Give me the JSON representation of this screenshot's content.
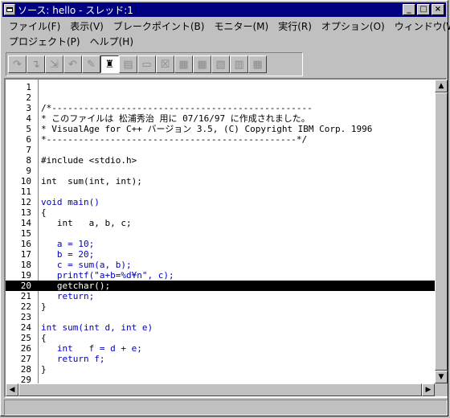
{
  "window": {
    "title": "ソース: hello - スレッド:1",
    "controls": {
      "minimize": "_",
      "maximize": "□",
      "close": "×"
    }
  },
  "menu": {
    "row1": [
      "ファイル(F)",
      "表示(V)",
      "ブレークポイント(B)",
      "モニター(M)",
      "実行(R)",
      "オプション(O)",
      "ウィンドウ(W)"
    ],
    "row2": [
      "プロジェクト(P)",
      "ヘルプ(H)"
    ]
  },
  "toolbar": {
    "buttons": [
      {
        "icon": "step-over-icon",
        "glyph": "↷",
        "state": "disabled"
      },
      {
        "icon": "step-into-icon",
        "glyph": "↴",
        "state": "disabled"
      },
      {
        "icon": "step-debug-icon",
        "glyph": "⇲",
        "state": "disabled"
      },
      {
        "icon": "step-return-icon",
        "glyph": "↶",
        "state": "disabled"
      },
      {
        "icon": "run-icon",
        "glyph": "✎",
        "state": "disabled"
      },
      {
        "icon": "run-to-cursor-icon",
        "glyph": "♜",
        "state": "active"
      },
      {
        "icon": "breakpoints-icon",
        "glyph": "▤",
        "state": "disabled"
      },
      {
        "icon": "source-icon",
        "glyph": "▭",
        "state": "disabled"
      },
      {
        "icon": "call-stack-icon",
        "glyph": "☒",
        "state": "disabled"
      },
      {
        "icon": "registers-icon",
        "glyph": "▦",
        "state": "disabled"
      },
      {
        "icon": "storage-icon",
        "glyph": "▦",
        "state": "disabled"
      },
      {
        "icon": "variables-icon",
        "glyph": "▧",
        "state": "disabled"
      },
      {
        "icon": "monitor-icon",
        "glyph": "▥",
        "state": "disabled"
      },
      {
        "icon": "threads-icon",
        "glyph": "▦",
        "state": "disabled"
      }
    ]
  },
  "editor": {
    "current_line": 20,
    "lines": [
      {
        "n": "1",
        "text": "",
        "blue": false
      },
      {
        "n": "2",
        "text": "",
        "blue": false
      },
      {
        "n": "3",
        "text": "/*-------------------------------------------------",
        "blue": false
      },
      {
        "n": "4",
        "text": "* このファイルは 松浦秀治 用に 07/16/97 に作成されました。",
        "blue": false
      },
      {
        "n": "5",
        "text": "* VisualAge for C++ バージョン 3.5, (C) Copyright IBM Corp. 1996",
        "blue": false
      },
      {
        "n": "6",
        "text": "*-----------------------------------------------*/",
        "blue": false
      },
      {
        "n": "7",
        "text": "",
        "blue": false
      },
      {
        "n": "8",
        "text": "#include <stdio.h>",
        "blue": false
      },
      {
        "n": "9",
        "text": "",
        "blue": false
      },
      {
        "n": "10",
        "text": "int  sum(int, int);",
        "blue": false
      },
      {
        "n": "11",
        "text": "",
        "blue": false
      },
      {
        "n": "12",
        "text": "void main()",
        "blue": true
      },
      {
        "n": "13",
        "text": "{",
        "blue": false
      },
      {
        "n": "14",
        "text": "   int   a, b, c;",
        "blue": false
      },
      {
        "n": "15",
        "text": "",
        "blue": false
      },
      {
        "n": "16",
        "text": "   a = 10;",
        "blue": true
      },
      {
        "n": "17",
        "text": "   b = 20;",
        "blue": true
      },
      {
        "n": "18",
        "text": "   c = sum(a, b);",
        "blue": true
      },
      {
        "n": "19",
        "text": "   printf(\"a+b=%d¥n\", c);",
        "blue": true
      },
      {
        "n": "20",
        "text": "   getchar();",
        "blue": false
      },
      {
        "n": "21",
        "text": "   return;",
        "blue": true
      },
      {
        "n": "22",
        "text": "}",
        "blue": false
      },
      {
        "n": "23",
        "text": "",
        "blue": false
      },
      {
        "n": "24",
        "text": "int sum(int d, int e)",
        "blue": true
      },
      {
        "n": "25",
        "text": "{",
        "blue": false
      },
      {
        "n": "26",
        "text": "   int   f = d + e;",
        "blue": true
      },
      {
        "n": "27",
        "text": "   return f;",
        "blue": true
      },
      {
        "n": "28",
        "text": "}",
        "blue": false
      },
      {
        "n": "29",
        "text": "",
        "blue": false
      }
    ]
  },
  "scroll": {
    "up": "▲",
    "down": "▼",
    "left": "◀",
    "right": "▶"
  },
  "status": {
    "text": ""
  }
}
